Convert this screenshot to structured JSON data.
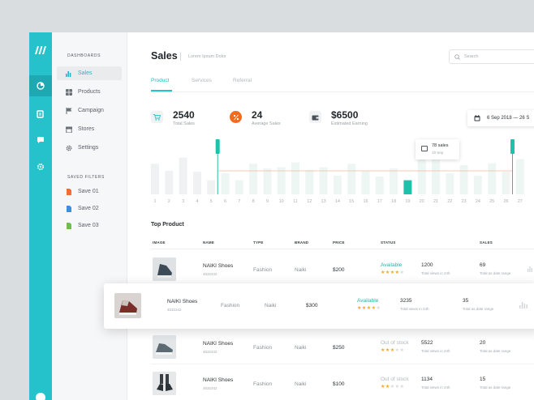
{
  "sidebar": {
    "dashboards_heading": "DASHBOARDS",
    "items": [
      {
        "label": "Sales",
        "icon": "bar-chart-icon",
        "active": true
      },
      {
        "label": "Products",
        "icon": "grid-icon",
        "active": false
      },
      {
        "label": "Campaign",
        "icon": "flag-icon",
        "active": false
      },
      {
        "label": "Stores",
        "icon": "store-icon",
        "active": false
      },
      {
        "label": "Settings",
        "icon": "gear-icon",
        "active": false
      }
    ],
    "saved_heading": "SAVED FILTERS",
    "saved": [
      {
        "label": "Save 01",
        "color": "#f26b3a"
      },
      {
        "label": "Save 02",
        "color": "#3b8fe0"
      },
      {
        "label": "Save 03",
        "color": "#6cc04a"
      }
    ]
  },
  "header": {
    "title": "Sales",
    "subtitle": "Lorem Ipsum Dolor",
    "search_placeholder": "Search"
  },
  "tabs": [
    {
      "label": "Product",
      "active": true
    },
    {
      "label": "Services",
      "active": false
    },
    {
      "label": "Referral",
      "active": false
    }
  ],
  "stats": [
    {
      "value": "2540",
      "label": "Total Sales",
      "icon": "cart-icon",
      "color": "#25c2cc"
    },
    {
      "value": "24",
      "label": "Average Sales",
      "icon": "percent-icon",
      "color": "#f26b1f"
    },
    {
      "value": "$6500",
      "label": "Estimated Earning",
      "icon": "wallet-icon",
      "color": "#4a5058"
    }
  ],
  "date_range": {
    "text": "6 Sep 2018  —  26 S"
  },
  "chart_data": {
    "type": "bar",
    "categories": [
      "1",
      "2",
      "3",
      "4",
      "5",
      "6",
      "7",
      "8",
      "9",
      "10",
      "11",
      "12",
      "13",
      "14",
      "15",
      "16",
      "17",
      "18",
      "19",
      "20",
      "21",
      "22",
      "23",
      "24",
      "25",
      "26",
      "27"
    ],
    "values": [
      65,
      50,
      78,
      48,
      30,
      45,
      30,
      65,
      55,
      58,
      68,
      52,
      58,
      40,
      65,
      50,
      38,
      55,
      30,
      98,
      78,
      45,
      62,
      40,
      66,
      48,
      75
    ],
    "highlight_index": 18,
    "ylim": [
      0,
      100
    ],
    "ylabel": "",
    "xlabel": "",
    "range_start_index": 4,
    "accent": "#20c1aa",
    "bar_color": "#f0f1f2",
    "selected_bar_color": "#eef6f3"
  },
  "tooltip": {
    "sales": "78 sales",
    "date": "19 Sep"
  },
  "table": {
    "title": "Top Product",
    "headers": [
      "IMAGE",
      "NAME",
      "TYPE",
      "BRAND",
      "PRICE",
      "STATUS",
      "SALES"
    ],
    "rows": [
      {
        "name": "NAIKI Shoes",
        "sku": "4532342",
        "type": "Fashion",
        "brand": "Naiki",
        "price": "$200",
        "status": "Available",
        "stars": 4,
        "views": "1200",
        "views_label": "Total views in 24h",
        "sales": "69",
        "sales_label": "Total as date range"
      },
      {
        "name": "NAIKI Shoes",
        "sku": "4532342",
        "type": "Fashion",
        "brand": "Naiki",
        "price": "$300",
        "status": "Available",
        "stars": 4,
        "views": "3235",
        "views_label": "Total views in 24h",
        "sales": "35",
        "sales_label": "Total as date range"
      },
      {
        "name": "NAIKI Shoes",
        "sku": "4532342",
        "type": "Fashion",
        "brand": "Naiki",
        "price": "$250",
        "status": "Out of stock",
        "stars": 3,
        "views": "5522",
        "views_label": "Total views in 24h",
        "sales": "20",
        "sales_label": "Total as date range"
      },
      {
        "name": "NAIKI Shoes",
        "sku": "4532342",
        "type": "Fashion",
        "brand": "Naiki",
        "price": "$100",
        "status": "Out of stock",
        "stars": 2,
        "views": "1134",
        "views_label": "Total views in 24h",
        "sales": "15",
        "sales_label": "Total as date range"
      }
    ]
  }
}
